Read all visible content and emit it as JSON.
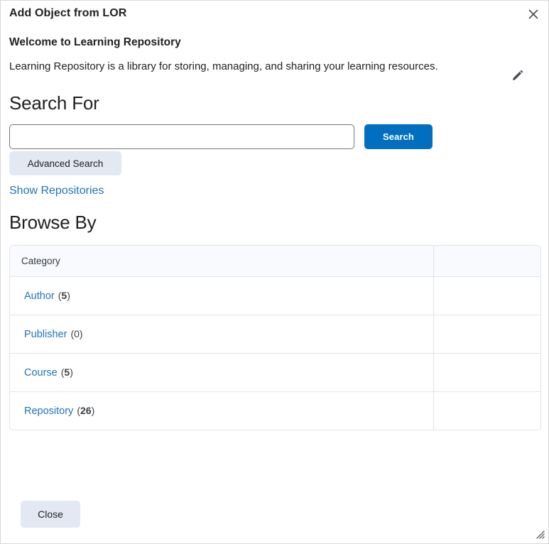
{
  "dialog": {
    "title": "Add Object from LOR",
    "close_icon": "close-icon"
  },
  "welcome": {
    "heading": "Welcome to Learning Repository",
    "description": "Learning Repository is a library for storing, managing, and sharing your learning resources.",
    "edit_icon": "pencil-icon"
  },
  "search": {
    "heading": "Search For",
    "input_value": "",
    "input_placeholder": "",
    "submit_label": "Search",
    "advanced_label": "Advanced Search",
    "show_repositories_label": "Show Repositories"
  },
  "browse": {
    "heading": "Browse By",
    "columns": [
      "Category",
      ""
    ],
    "rows": [
      {
        "label": "Author",
        "count": "5",
        "count_bold": true
      },
      {
        "label": "Publisher",
        "count": "0",
        "count_bold": false
      },
      {
        "label": "Course",
        "count": "5",
        "count_bold": true
      },
      {
        "label": "Repository",
        "count": "26",
        "count_bold": true
      }
    ]
  },
  "footer": {
    "close_label": "Close",
    "resize_icon": "resize-grip-icon"
  },
  "colors": {
    "accent_blue": "#006fbf",
    "link_blue": "#2074bc",
    "button_grey": "#e2e9f3",
    "table_header_bg": "#f8fafd",
    "border": "#dfe4ea",
    "text": "#202122"
  }
}
